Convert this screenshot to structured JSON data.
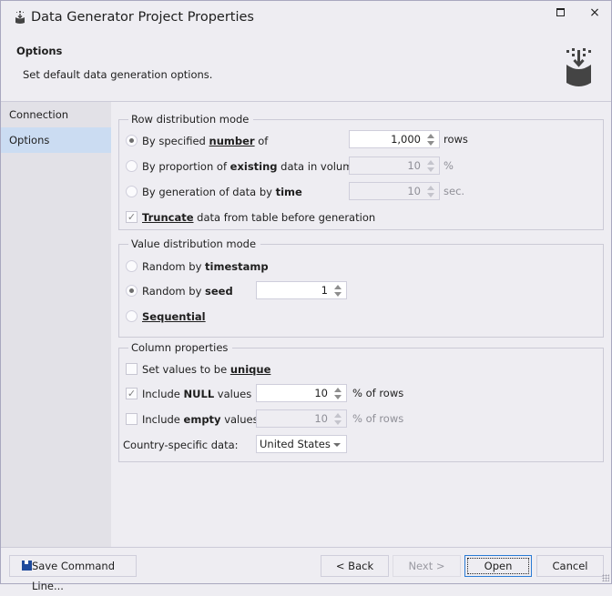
{
  "window": {
    "title": "Data Generator Project Properties",
    "app_icon": "data-generator-icon",
    "controls": {
      "maximize": "maximize-icon",
      "close": "×"
    }
  },
  "header": {
    "title": "Options",
    "description": "Set default data generation options.",
    "icon": "database-import-icon"
  },
  "sidebar": {
    "items": [
      {
        "label": "Connection",
        "active": false
      },
      {
        "label": "Options",
        "active": true
      }
    ]
  },
  "row_distribution": {
    "legend": "Row distribution mode",
    "options": [
      {
        "pre": "By specified ",
        "bold": "number",
        "post": " of",
        "checked": true,
        "value": "1,000",
        "unit": "rows",
        "enabled": true
      },
      {
        "pre": "By proportion of ",
        "bold": "existing",
        "post": " data in volume of",
        "checked": false,
        "value": "10",
        "unit": "%",
        "enabled": false
      },
      {
        "pre": "By generation of data by ",
        "bold": "time",
        "post": "",
        "checked": false,
        "value": "10",
        "unit": "sec.",
        "enabled": false
      }
    ],
    "truncate": {
      "bold": "Truncate",
      "post": " data from table before generation",
      "checked": true
    }
  },
  "value_distribution": {
    "legend": "Value distribution mode",
    "options": [
      {
        "pre": "Random by ",
        "bold": "timestamp",
        "checked": false
      },
      {
        "pre": "Random by ",
        "bold": "seed",
        "checked": true,
        "value": "1"
      },
      {
        "pre": "",
        "bold": "Sequential",
        "checked": false
      }
    ]
  },
  "column_properties": {
    "legend": "Column properties",
    "unique": {
      "pre": "Set values to be ",
      "bold": "unique",
      "checked": false
    },
    "null_values": {
      "pre": "Include ",
      "bold": "NULL",
      "post": " values",
      "checked": true,
      "value": "10",
      "unit": "% of rows"
    },
    "empty_values": {
      "pre": "Include ",
      "bold": "empty",
      "post": " values",
      "checked": false,
      "value": "10",
      "unit": "% of rows"
    },
    "country": {
      "label": "Country-specific data:",
      "value": "United States"
    }
  },
  "footer": {
    "save_command_line": "Save Command Line...",
    "back": "< Back",
    "next": "Next >",
    "open": "Open",
    "cancel": "Cancel"
  },
  "marks": {
    "check": "✓"
  }
}
